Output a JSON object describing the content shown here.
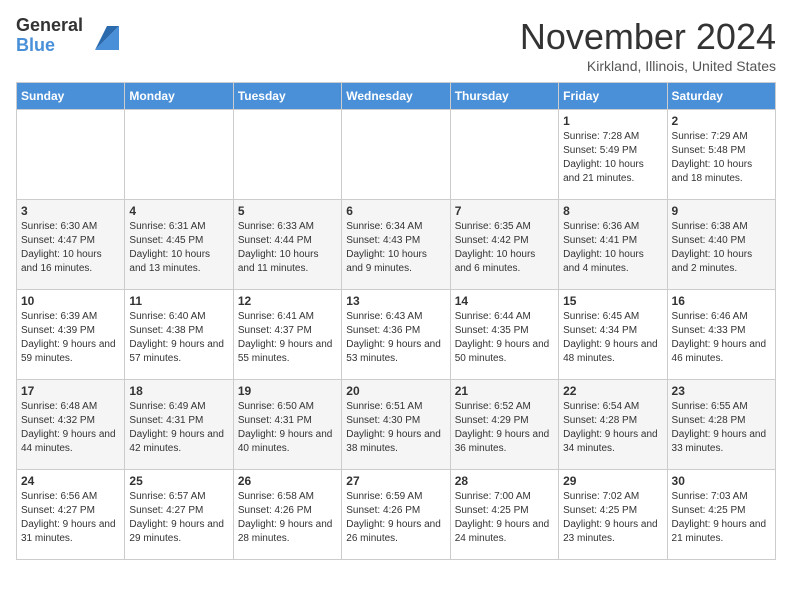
{
  "logo": {
    "general": "General",
    "blue": "Blue"
  },
  "header": {
    "title": "November 2024",
    "location": "Kirkland, Illinois, United States"
  },
  "weekdays": [
    "Sunday",
    "Monday",
    "Tuesday",
    "Wednesday",
    "Thursday",
    "Friday",
    "Saturday"
  ],
  "weeks": [
    [
      {
        "day": "",
        "info": ""
      },
      {
        "day": "",
        "info": ""
      },
      {
        "day": "",
        "info": ""
      },
      {
        "day": "",
        "info": ""
      },
      {
        "day": "",
        "info": ""
      },
      {
        "day": "1",
        "info": "Sunrise: 7:28 AM\nSunset: 5:49 PM\nDaylight: 10 hours and 21 minutes."
      },
      {
        "day": "2",
        "info": "Sunrise: 7:29 AM\nSunset: 5:48 PM\nDaylight: 10 hours and 18 minutes."
      }
    ],
    [
      {
        "day": "3",
        "info": "Sunrise: 6:30 AM\nSunset: 4:47 PM\nDaylight: 10 hours and 16 minutes."
      },
      {
        "day": "4",
        "info": "Sunrise: 6:31 AM\nSunset: 4:45 PM\nDaylight: 10 hours and 13 minutes."
      },
      {
        "day": "5",
        "info": "Sunrise: 6:33 AM\nSunset: 4:44 PM\nDaylight: 10 hours and 11 minutes."
      },
      {
        "day": "6",
        "info": "Sunrise: 6:34 AM\nSunset: 4:43 PM\nDaylight: 10 hours and 9 minutes."
      },
      {
        "day": "7",
        "info": "Sunrise: 6:35 AM\nSunset: 4:42 PM\nDaylight: 10 hours and 6 minutes."
      },
      {
        "day": "8",
        "info": "Sunrise: 6:36 AM\nSunset: 4:41 PM\nDaylight: 10 hours and 4 minutes."
      },
      {
        "day": "9",
        "info": "Sunrise: 6:38 AM\nSunset: 4:40 PM\nDaylight: 10 hours and 2 minutes."
      }
    ],
    [
      {
        "day": "10",
        "info": "Sunrise: 6:39 AM\nSunset: 4:39 PM\nDaylight: 9 hours and 59 minutes."
      },
      {
        "day": "11",
        "info": "Sunrise: 6:40 AM\nSunset: 4:38 PM\nDaylight: 9 hours and 57 minutes."
      },
      {
        "day": "12",
        "info": "Sunrise: 6:41 AM\nSunset: 4:37 PM\nDaylight: 9 hours and 55 minutes."
      },
      {
        "day": "13",
        "info": "Sunrise: 6:43 AM\nSunset: 4:36 PM\nDaylight: 9 hours and 53 minutes."
      },
      {
        "day": "14",
        "info": "Sunrise: 6:44 AM\nSunset: 4:35 PM\nDaylight: 9 hours and 50 minutes."
      },
      {
        "day": "15",
        "info": "Sunrise: 6:45 AM\nSunset: 4:34 PM\nDaylight: 9 hours and 48 minutes."
      },
      {
        "day": "16",
        "info": "Sunrise: 6:46 AM\nSunset: 4:33 PM\nDaylight: 9 hours and 46 minutes."
      }
    ],
    [
      {
        "day": "17",
        "info": "Sunrise: 6:48 AM\nSunset: 4:32 PM\nDaylight: 9 hours and 44 minutes."
      },
      {
        "day": "18",
        "info": "Sunrise: 6:49 AM\nSunset: 4:31 PM\nDaylight: 9 hours and 42 minutes."
      },
      {
        "day": "19",
        "info": "Sunrise: 6:50 AM\nSunset: 4:31 PM\nDaylight: 9 hours and 40 minutes."
      },
      {
        "day": "20",
        "info": "Sunrise: 6:51 AM\nSunset: 4:30 PM\nDaylight: 9 hours and 38 minutes."
      },
      {
        "day": "21",
        "info": "Sunrise: 6:52 AM\nSunset: 4:29 PM\nDaylight: 9 hours and 36 minutes."
      },
      {
        "day": "22",
        "info": "Sunrise: 6:54 AM\nSunset: 4:28 PM\nDaylight: 9 hours and 34 minutes."
      },
      {
        "day": "23",
        "info": "Sunrise: 6:55 AM\nSunset: 4:28 PM\nDaylight: 9 hours and 33 minutes."
      }
    ],
    [
      {
        "day": "24",
        "info": "Sunrise: 6:56 AM\nSunset: 4:27 PM\nDaylight: 9 hours and 31 minutes."
      },
      {
        "day": "25",
        "info": "Sunrise: 6:57 AM\nSunset: 4:27 PM\nDaylight: 9 hours and 29 minutes."
      },
      {
        "day": "26",
        "info": "Sunrise: 6:58 AM\nSunset: 4:26 PM\nDaylight: 9 hours and 28 minutes."
      },
      {
        "day": "27",
        "info": "Sunrise: 6:59 AM\nSunset: 4:26 PM\nDaylight: 9 hours and 26 minutes."
      },
      {
        "day": "28",
        "info": "Sunrise: 7:00 AM\nSunset: 4:25 PM\nDaylight: 9 hours and 24 minutes."
      },
      {
        "day": "29",
        "info": "Sunrise: 7:02 AM\nSunset: 4:25 PM\nDaylight: 9 hours and 23 minutes."
      },
      {
        "day": "30",
        "info": "Sunrise: 7:03 AM\nSunset: 4:25 PM\nDaylight: 9 hours and 21 minutes."
      }
    ]
  ]
}
